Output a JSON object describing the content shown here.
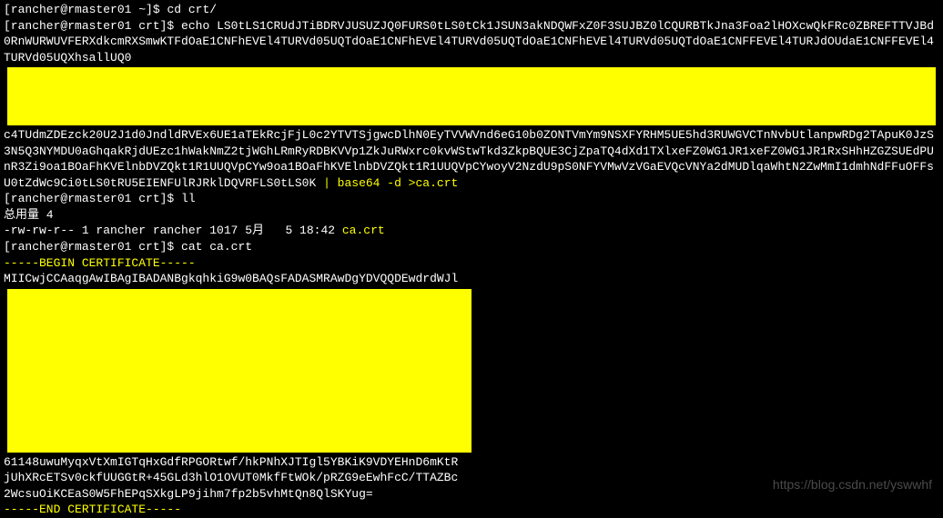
{
  "lines": {
    "l1_prompt": "[rancher@rmaster01 ~]$ ",
    "l1_cmd": "cd crt/",
    "l2_prompt": "[rancher@rmaster01 crt]$ ",
    "l2_cmd": "echo ",
    "l2_payload_1": "LS0tLS1CRUdJTiBDRVJUSUZJQ0FURS0tLS0tCk1JSUN3akNDQWFxZ0F3SUJBZ0lCQURBTkJna3Foa2lHOXcwQkFRc0ZBREFTTVJBd0RnWURWUVFERXdkcmRXSmwKTFdOaE1CNFhEVEl4TURVd05UQTdOaE1CNFhEVEl4TURVd05UQTdOaE1CNFhEVEl4TURVd05UQTdOaE1CNFFEVEl4TURJdOUdaE1CNFFEVEl4TURVd05UQXhsallUQ0",
    "l3_payload": "c4TUdmZDEzck20U2J1d0JndldRVEx6UE1aTEkRcjFjL0c2YTVTSjgwcDlhN0EyTVVWVnd6eG10b0ZONTVmYm9NSXFYRHM5UE5hd3RUWGVCTnNvbUtlanpwRDg2TApuK0JzS3N5Q3NYMDU0aGhqakRjdUEzc1hWakNmZ2tjWGhLRmRyRDBKVVp1ZkJuRWxrc0kvWStwTkd3ZkpBQUE3CjZpaTQ4dXd1TXlxeFZ0WG1JR1xeFZ0WG1JR1RxSHhHZGZSUEdPUnR3Zi9oa1BOaFhKVElnbDVZQkt1R1UUQVpCYw9oa1BOaFhKVElnbDVZQkt1R1UUQVpCYwoyV2NzdU9pS0NFYVMwVzVGaEVQcVNYa2dMUDlqaWhtN2ZwMmI1dmhNdFFuOFFsU0tZdWc9Ci0tLS0tRU5EIENFUlRJRklDQVRFLS0tLS0K",
    "l3_pipe": " | base64 -d >ca.crt",
    "l4_prompt": "[rancher@rmaster01 crt]$ ",
    "l4_cmd": "ll",
    "l5": "总用量 4",
    "l6_perm": "-rw-rw-r-- 1 rancher rancher 1017 5月   5 18:42 ",
    "l6_file": "ca.crt",
    "l7_prompt": "[rancher@rmaster01 crt]$ ",
    "l7_cmd": "cat ca.crt",
    "l8": "-----BEGIN CERTIFICATE-----",
    "l9": "MIICwjCCAaqgAwIBAgIBADANBgkqhkiG9w0BAQsFADASMRAwDgYDVQQDEwdrdWJl",
    "l10": "61148uwuMyqxVtXmIGTqHxGdfRPGORtwf/hkPNhXJTIgl5YBKiK9VDYEHnD6mKtR",
    "l11": "jUhXRcETSv0ckfUUGGtR+45GLd3hlO1OVUT0MkfFtWOk/pRZG9eEwhFcC/TTAZBc",
    "l12": "2WcsuOiKCEaS0W5FhEPqSXkgLP9jihm7fp2b5vhMtQn8QlSKYug=",
    "l13": "-----END CERTIFICATE-----"
  },
  "watermark": "https://blog.csdn.net/yswwhf"
}
